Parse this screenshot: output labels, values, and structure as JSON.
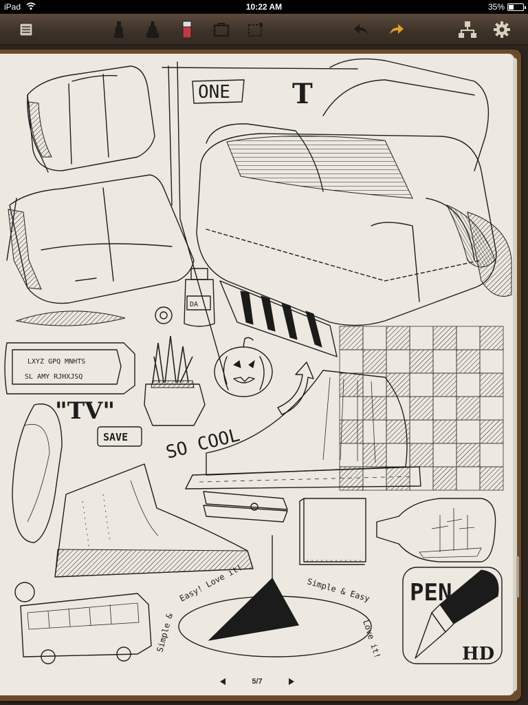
{
  "status_bar": {
    "carrier": "iPad",
    "time": "10:22 AM",
    "battery_percent": "35%",
    "battery_level": 0.35
  },
  "toolbar": {
    "left_icon": "notebook-list-icon",
    "tools": [
      "pen-tool-icon",
      "marker-tool-icon",
      "eraser-tool-icon",
      "shape-tool-icon",
      "selection-tool-icon"
    ],
    "undo_icon": "undo-icon",
    "redo_icon": "redo-icon",
    "share_icon": "export-icon",
    "settings_icon": "gear-icon",
    "accent_redo": "#e0a020",
    "accent_eraser": "#c0393f"
  },
  "canvas": {
    "labels": {
      "one": "ONE",
      "t": "T",
      "tv": "\"TV\"",
      "save": "SAVE",
      "so_cool": "SO COOL",
      "gum_top": "LXYZ  GPQ MNHTS",
      "gum_bottom": "SL AMY RJHXJSQ",
      "bottle_tag": "DA",
      "pen": "PEN",
      "hd": "HD",
      "dial_left": "Easy! Love it!",
      "dial_left2": "Simple &",
      "dial_right": "Simple & Easy",
      "dial_right2": "Love it!"
    }
  },
  "pager": {
    "current": "5/7"
  }
}
